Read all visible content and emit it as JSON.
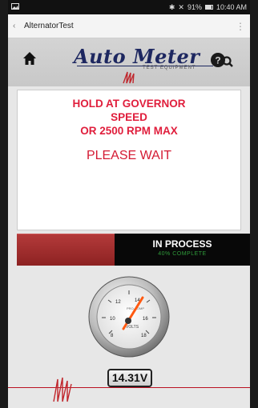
{
  "status_bar": {
    "left_icon": "image-icon",
    "right_text": "91%",
    "time": "10:40 AM"
  },
  "app_bar": {
    "title": "AlternatorTest",
    "back_icon": "chevron-left-icon",
    "menu_icon": "overflow-menu-icon"
  },
  "header": {
    "home_icon": "home-icon",
    "logo_text": "Auto Meter",
    "logo_subtext": "TEST EQUIPMENT",
    "help_icon": "help-magnify-icon",
    "brand_color": "#1d2760"
  },
  "message": {
    "line1": "HOLD AT GOVERNOR",
    "line2": "SPEED",
    "line3": "OR 2500 RPM MAX",
    "wait": "PLEASE WAIT",
    "warning_color": "#e01e3c"
  },
  "progress": {
    "status": "IN PROCESS",
    "percent_text": "40% COMPLETE",
    "fraction": 0.4,
    "bar_color": "#a02b2b"
  },
  "gauge": {
    "ticks": [
      "8",
      "10",
      "12",
      "14",
      "16",
      "18"
    ],
    "unit": "VOLTS",
    "brand": "PRO-COMP",
    "value": 14.31
  },
  "readout": {
    "value": "14.31V"
  }
}
